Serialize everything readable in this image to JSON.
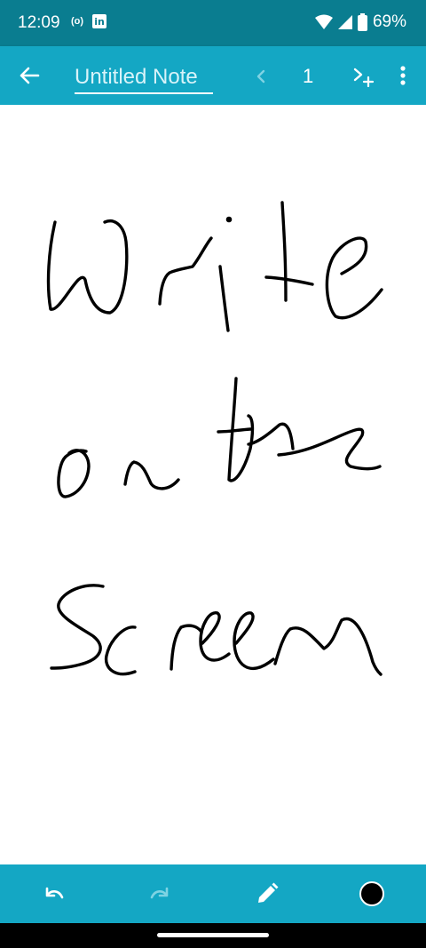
{
  "status_bar": {
    "time": "12:09",
    "hotspot_icon": "(o)",
    "linkedin_icon": "in",
    "battery_percent": "69%",
    "icons": [
      "hotspot-icon",
      "linkedin-icon",
      "wifi-icon",
      "cell-signal-icon",
      "battery-icon"
    ]
  },
  "app_bar": {
    "title_placeholder": "Untitled Note",
    "page_number": "1",
    "icons": [
      "back-arrow-icon",
      "chevron-left-icon",
      "add-page-icon",
      "more-vert-icon"
    ]
  },
  "canvas": {
    "handwritten_text": [
      "Write",
      "on the",
      "Screen"
    ],
    "ink_color": "#000000"
  },
  "bottom_toolbar": {
    "icons": [
      "undo-icon",
      "redo-icon",
      "pen-icon",
      "color-swatch-icon"
    ],
    "selected_color": "#000000"
  },
  "colors": {
    "status_bar": "#0a7d90",
    "app_bar": "#14a7c4",
    "disabled_icon": "#7fd3e3",
    "canvas": "#ffffff"
  }
}
